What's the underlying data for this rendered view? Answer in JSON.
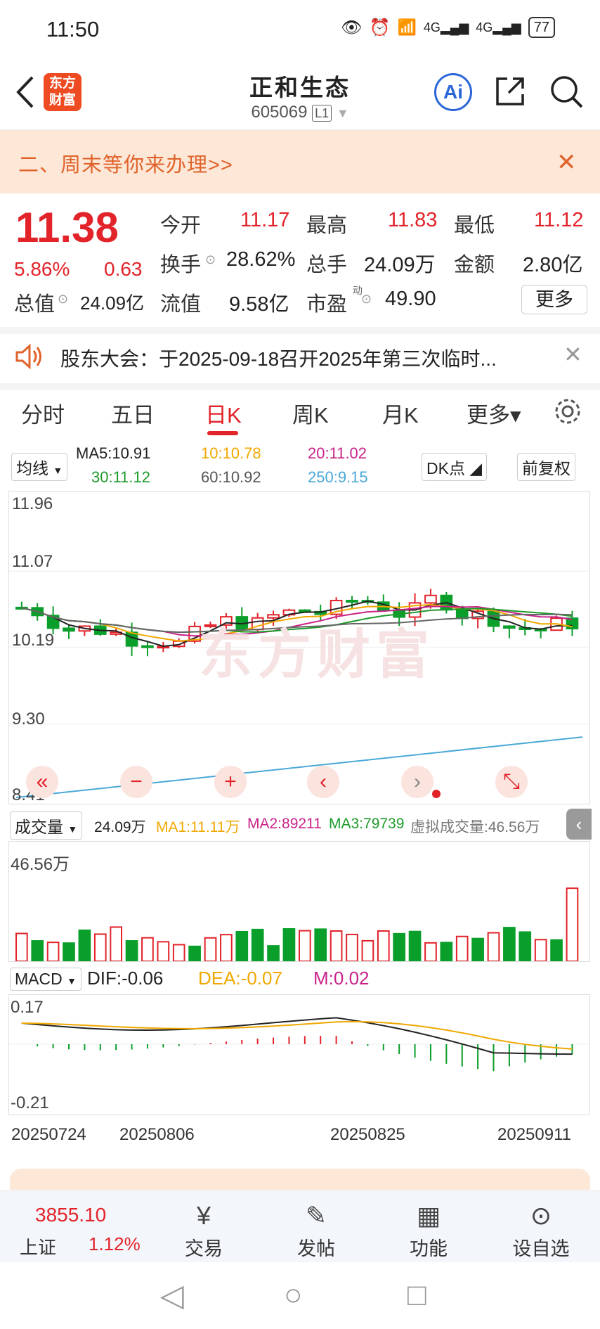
{
  "status_bar": {
    "time": "11:50",
    "battery": "77",
    "icons": [
      "eye-icon",
      "alarm-icon",
      "wifi-icon",
      "signal-4g-icon",
      "signal-4g-icon",
      "battery-icon"
    ]
  },
  "header": {
    "logo_line1": "东方",
    "logo_line2": "财富",
    "title": "正和生态",
    "code": "605069",
    "level": "L1",
    "ai_label": "Ai"
  },
  "banner": {
    "text": "二、周末等你来办理>>"
  },
  "quote": {
    "price": "11.38",
    "change_pct": "5.86%",
    "change": "0.63",
    "fields": [
      {
        "label": "今开",
        "value": "11.17"
      },
      {
        "label": "最高",
        "value": "11.83"
      },
      {
        "label": "最低",
        "value": "11.12"
      },
      {
        "label": "换手",
        "value": "28.62%"
      },
      {
        "label": "总手",
        "value": "24.09万"
      },
      {
        "label": "金额",
        "value": "2.80亿"
      },
      {
        "label": "总值",
        "value": "24.09亿"
      },
      {
        "label": "流值",
        "value": "9.58亿"
      },
      {
        "label": "市盈",
        "value": "49.90"
      }
    ],
    "more": "更多",
    "pe_sup": "动"
  },
  "notice": {
    "text": "股东大会：于2025-09-18召开2025年第三次临时..."
  },
  "tabs": [
    {
      "label": "分时"
    },
    {
      "label": "五日"
    },
    {
      "label": "日K"
    },
    {
      "label": "周K"
    },
    {
      "label": "月K"
    },
    {
      "label": "更多▾"
    }
  ],
  "kline": {
    "selector": "均线",
    "ma": {
      "ma5": "MA5:10.91",
      "ma10": "10:10.78",
      "ma20": "20:11.02",
      "ma30": "30:11.12",
      "ma60": "60:10.92",
      "ma250": "250:9.15"
    },
    "dk_label": "DK点",
    "fq_label": "前复权",
    "y_labels": [
      "11.96",
      "11.07",
      "10.19",
      "9.30",
      "8.41"
    ],
    "watermark": "东方财富",
    "colors": {
      "up": "#e2232a",
      "down": "#0a9e2a",
      "ma5": "#222222",
      "ma10": "#f0a800",
      "ma20": "#c8238a",
      "ma30": "#1d9a2a",
      "ma60": "#666666",
      "ma250": "#4aa8d8"
    }
  },
  "volume": {
    "selector": "成交量",
    "value": "24.09万",
    "ma1": "MA1:11.11万",
    "ma2": "MA2:89211",
    "ma3": "MA3:79739",
    "virtual": "虚拟成交量:46.56万",
    "y_max": "46.56万"
  },
  "macd": {
    "selector": "MACD",
    "dif": "DIF:-0.06",
    "dea": "DEA:-0.07",
    "m": "M:0.02",
    "y_top": "0.17",
    "y_bottom": "-0.21"
  },
  "dates": [
    "20250724",
    "20250806",
    "20250825",
    "20250911"
  ],
  "chart_data": {
    "type": "candlestick",
    "x": [
      "20250724",
      "20250806",
      "20250825",
      "20250911"
    ],
    "ylim": [
      8.41,
      11.96
    ],
    "last_close": 11.38
  },
  "bottom_nav": {
    "index_value": "3855.10",
    "index_name": "上证",
    "index_pct": "1.12%",
    "items": [
      {
        "label": "交易"
      },
      {
        "label": "发帖"
      },
      {
        "label": "功能"
      },
      {
        "label": "设自选"
      }
    ]
  }
}
